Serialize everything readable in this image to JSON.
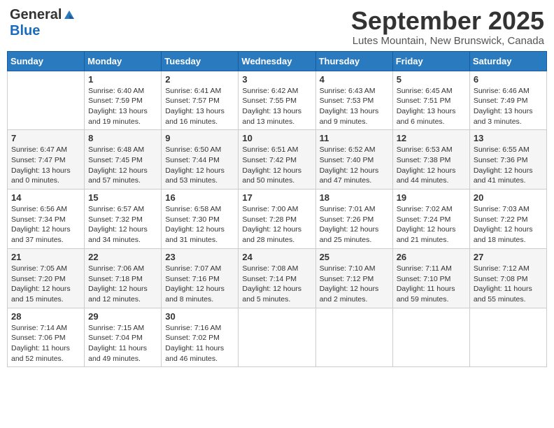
{
  "logo": {
    "general": "General",
    "blue": "Blue"
  },
  "title": "September 2025",
  "subtitle": "Lutes Mountain, New Brunswick, Canada",
  "days_of_week": [
    "Sunday",
    "Monday",
    "Tuesday",
    "Wednesday",
    "Thursday",
    "Friday",
    "Saturday"
  ],
  "weeks": [
    [
      {
        "day": "",
        "info": ""
      },
      {
        "day": "1",
        "info": "Sunrise: 6:40 AM\nSunset: 7:59 PM\nDaylight: 13 hours\nand 19 minutes."
      },
      {
        "day": "2",
        "info": "Sunrise: 6:41 AM\nSunset: 7:57 PM\nDaylight: 13 hours\nand 16 minutes."
      },
      {
        "day": "3",
        "info": "Sunrise: 6:42 AM\nSunset: 7:55 PM\nDaylight: 13 hours\nand 13 minutes."
      },
      {
        "day": "4",
        "info": "Sunrise: 6:43 AM\nSunset: 7:53 PM\nDaylight: 13 hours\nand 9 minutes."
      },
      {
        "day": "5",
        "info": "Sunrise: 6:45 AM\nSunset: 7:51 PM\nDaylight: 13 hours\nand 6 minutes."
      },
      {
        "day": "6",
        "info": "Sunrise: 6:46 AM\nSunset: 7:49 PM\nDaylight: 13 hours\nand 3 minutes."
      }
    ],
    [
      {
        "day": "7",
        "info": "Sunrise: 6:47 AM\nSunset: 7:47 PM\nDaylight: 13 hours\nand 0 minutes."
      },
      {
        "day": "8",
        "info": "Sunrise: 6:48 AM\nSunset: 7:45 PM\nDaylight: 12 hours\nand 57 minutes."
      },
      {
        "day": "9",
        "info": "Sunrise: 6:50 AM\nSunset: 7:44 PM\nDaylight: 12 hours\nand 53 minutes."
      },
      {
        "day": "10",
        "info": "Sunrise: 6:51 AM\nSunset: 7:42 PM\nDaylight: 12 hours\nand 50 minutes."
      },
      {
        "day": "11",
        "info": "Sunrise: 6:52 AM\nSunset: 7:40 PM\nDaylight: 12 hours\nand 47 minutes."
      },
      {
        "day": "12",
        "info": "Sunrise: 6:53 AM\nSunset: 7:38 PM\nDaylight: 12 hours\nand 44 minutes."
      },
      {
        "day": "13",
        "info": "Sunrise: 6:55 AM\nSunset: 7:36 PM\nDaylight: 12 hours\nand 41 minutes."
      }
    ],
    [
      {
        "day": "14",
        "info": "Sunrise: 6:56 AM\nSunset: 7:34 PM\nDaylight: 12 hours\nand 37 minutes."
      },
      {
        "day": "15",
        "info": "Sunrise: 6:57 AM\nSunset: 7:32 PM\nDaylight: 12 hours\nand 34 minutes."
      },
      {
        "day": "16",
        "info": "Sunrise: 6:58 AM\nSunset: 7:30 PM\nDaylight: 12 hours\nand 31 minutes."
      },
      {
        "day": "17",
        "info": "Sunrise: 7:00 AM\nSunset: 7:28 PM\nDaylight: 12 hours\nand 28 minutes."
      },
      {
        "day": "18",
        "info": "Sunrise: 7:01 AM\nSunset: 7:26 PM\nDaylight: 12 hours\nand 25 minutes."
      },
      {
        "day": "19",
        "info": "Sunrise: 7:02 AM\nSunset: 7:24 PM\nDaylight: 12 hours\nand 21 minutes."
      },
      {
        "day": "20",
        "info": "Sunrise: 7:03 AM\nSunset: 7:22 PM\nDaylight: 12 hours\nand 18 minutes."
      }
    ],
    [
      {
        "day": "21",
        "info": "Sunrise: 7:05 AM\nSunset: 7:20 PM\nDaylight: 12 hours\nand 15 minutes."
      },
      {
        "day": "22",
        "info": "Sunrise: 7:06 AM\nSunset: 7:18 PM\nDaylight: 12 hours\nand 12 minutes."
      },
      {
        "day": "23",
        "info": "Sunrise: 7:07 AM\nSunset: 7:16 PM\nDaylight: 12 hours\nand 8 minutes."
      },
      {
        "day": "24",
        "info": "Sunrise: 7:08 AM\nSunset: 7:14 PM\nDaylight: 12 hours\nand 5 minutes."
      },
      {
        "day": "25",
        "info": "Sunrise: 7:10 AM\nSunset: 7:12 PM\nDaylight: 12 hours\nand 2 minutes."
      },
      {
        "day": "26",
        "info": "Sunrise: 7:11 AM\nSunset: 7:10 PM\nDaylight: 11 hours\nand 59 minutes."
      },
      {
        "day": "27",
        "info": "Sunrise: 7:12 AM\nSunset: 7:08 PM\nDaylight: 11 hours\nand 55 minutes."
      }
    ],
    [
      {
        "day": "28",
        "info": "Sunrise: 7:14 AM\nSunset: 7:06 PM\nDaylight: 11 hours\nand 52 minutes."
      },
      {
        "day": "29",
        "info": "Sunrise: 7:15 AM\nSunset: 7:04 PM\nDaylight: 11 hours\nand 49 minutes."
      },
      {
        "day": "30",
        "info": "Sunrise: 7:16 AM\nSunset: 7:02 PM\nDaylight: 11 hours\nand 46 minutes."
      },
      {
        "day": "",
        "info": ""
      },
      {
        "day": "",
        "info": ""
      },
      {
        "day": "",
        "info": ""
      },
      {
        "day": "",
        "info": ""
      }
    ]
  ]
}
